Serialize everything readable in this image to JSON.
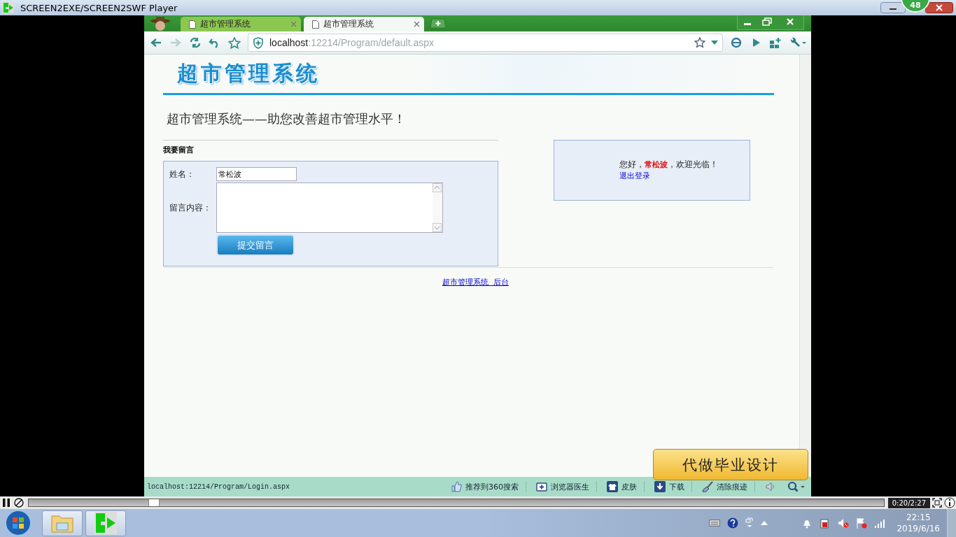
{
  "player": {
    "title": "SCREEN2EXE/SCREEN2SWF Player",
    "badge": "48",
    "time": "0:20/2:27",
    "progress": {
      "level": 0.14
    },
    "paused": false
  },
  "browser": {
    "tabs": [
      {
        "label": "超市管理系统",
        "selected": false
      },
      {
        "label": "超市管理系统",
        "selected": true
      }
    ],
    "address": {
      "host": "localhost",
      "path": ":12214/Program/default.aspx"
    },
    "page": {
      "logo": "超市管理系统",
      "slogan": "超市管理系统——助您改善超市管理水平！",
      "section_title": "我要留言",
      "form": {
        "fields": [
          {
            "kind": "text",
            "label": "姓名：",
            "value": "常松波"
          },
          {
            "kind": "textarea",
            "label": "留言内容："
          }
        ],
        "submit": "提交留言"
      },
      "welcome": {
        "greeting": "您好，**常松波**，欢迎光临！",
        "logout": "退出登录"
      },
      "footer_link": "超市管理系统  后台"
    },
    "status": {
      "url": "localhost:12214/Program/Login.aspx",
      "items": [
        {
          "kind": "thumb",
          "label": "推荐到360搜索"
        },
        {
          "kind": "doctor",
          "label": "浏览器医生"
        },
        {
          "kind": "shirt",
          "label": "皮肤"
        },
        {
          "kind": "download",
          "label": "下载"
        },
        {
          "kind": "broom",
          "label": "清除痕迹"
        }
      ]
    }
  },
  "ad": "代做毕业设计",
  "taskbar": {
    "time": "22:15",
    "date": "2019/6/16"
  }
}
